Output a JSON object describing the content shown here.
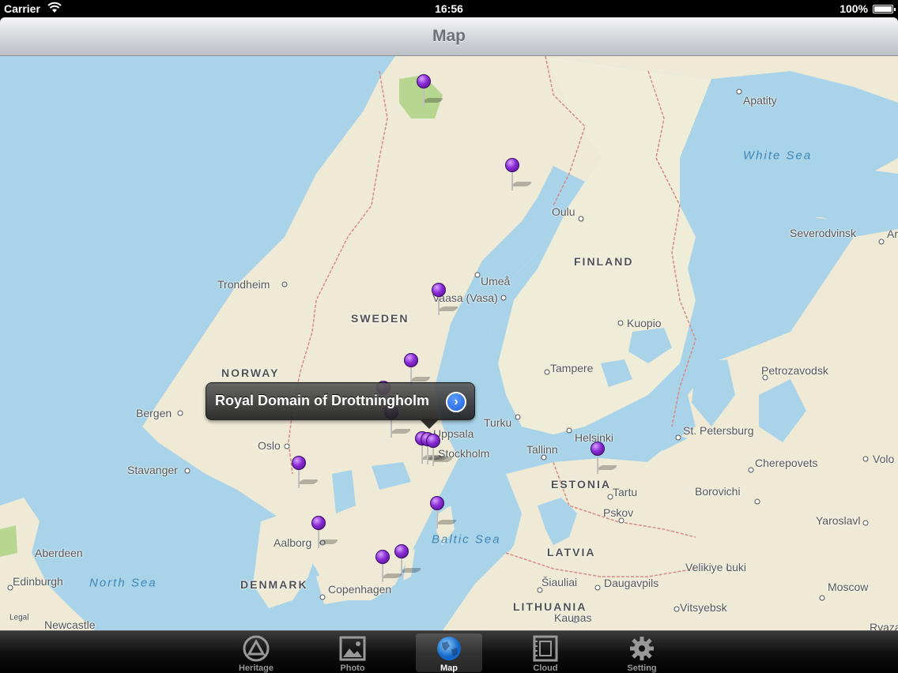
{
  "status_bar": {
    "carrier": "Carrier",
    "time": "16:56",
    "battery": "100%"
  },
  "nav_bar": {
    "title": "Map"
  },
  "map": {
    "legal": "Legal",
    "countries": [
      "NORWAY",
      "SWEDEN",
      "FINLAND",
      "ESTONIA",
      "LATVIA",
      "LITHUANIA",
      "DENMARK"
    ],
    "seas": [
      "White Sea",
      "Baltic Sea",
      "North Sea"
    ],
    "cities": [
      "Apatity",
      "Oulu",
      "Severodvinsk",
      "Ar",
      "Trondheim",
      "Umeå",
      "Vaasa (Vasa)",
      "Kuopio",
      "Tampere",
      "Petrozavodsk",
      "Bergen",
      "Turku",
      "Helsinki",
      "St. Petersburg",
      "Oslo",
      "Uppsala",
      "Stockholm",
      "Tallinn",
      "Stavanger",
      "Cherepovets",
      "Volo",
      "Tartu",
      "Borovichi",
      "Pskov",
      "Yaroslavl",
      "Aalborg",
      "Aberdeen",
      "Velikiye Luki",
      "Edinburgh",
      "Copenhagen",
      "Šiauliai",
      "Daugavpils",
      "Moscow",
      "Newcastle upon Tyne",
      "Kaunas",
      "Vitsyebsk",
      "Ryaza"
    ],
    "callout": {
      "title": "Royal Domain of Drottningholm",
      "icon": "disclosure-arrow-icon"
    }
  },
  "tab_bar": {
    "tabs": [
      {
        "label": "Heritage",
        "icon": "heritage-icon",
        "selected": false
      },
      {
        "label": "Photo",
        "icon": "photo-icon",
        "selected": false
      },
      {
        "label": "Map",
        "icon": "globe-icon",
        "selected": true
      },
      {
        "label": "Cloud",
        "icon": "cloud-icon",
        "selected": false
      },
      {
        "label": "Setting",
        "icon": "gear-icon",
        "selected": false
      }
    ]
  },
  "colors": {
    "water": "#a9d3e8",
    "land": "#eeead6",
    "park": "#b7d690",
    "pin": "#8a2bd6",
    "border": "#d88a86"
  }
}
